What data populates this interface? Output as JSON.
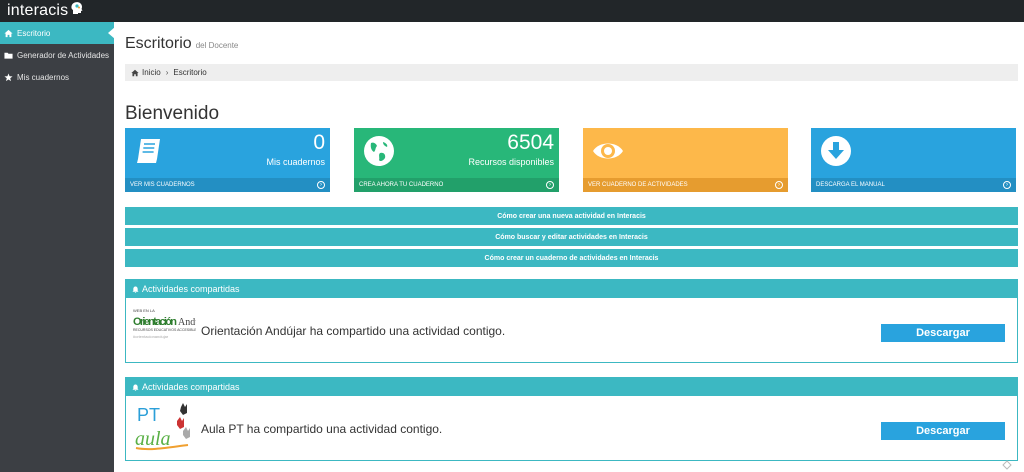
{
  "app": {
    "logo_text": "interacis"
  },
  "sidebar": {
    "items": [
      {
        "label": "Escritorio",
        "icon": "home-icon",
        "active": true
      },
      {
        "label": "Generador de Actividades",
        "icon": "folder-icon",
        "active": false
      },
      {
        "label": "Mis cuadernos",
        "icon": "star-icon",
        "active": false
      }
    ]
  },
  "header": {
    "title": "Escritorio",
    "subtitle": "del Docente"
  },
  "breadcrumb": {
    "home": "Inicio",
    "current": "Escritorio"
  },
  "welcome": "Bienvenido",
  "cards": [
    {
      "value": "0",
      "label": "Mis cuadernos",
      "footer": "VER MIS CUADERNOS",
      "color": "#29a3de",
      "foot_color": "#238fc3",
      "icon": "notebook-icon"
    },
    {
      "value": "6504",
      "label": "Recursos disponibles",
      "footer": "CREA AHORA TU CUADERNO",
      "color": "#28b779",
      "foot_color": "#22a06a",
      "icon": "globe-icon"
    },
    {
      "value": "",
      "label": "",
      "footer": "VER CUADERNO DE ACTIVIDADES",
      "color": "#fdb84a",
      "foot_color": "#e69c2f",
      "icon": "eye-icon"
    },
    {
      "value": "",
      "label": "",
      "footer": "DESCARGA EL MANUAL",
      "color": "#29a3de",
      "foot_color": "#238fc3",
      "icon": "download-icon"
    }
  ],
  "help_links": [
    "Cómo crear una nueva actividad en Interacis",
    "Cómo buscar y editar actividades en Interacis",
    "Cómo crear un cuaderno de actividades en Interacis"
  ],
  "shared": [
    {
      "header": "Actividades compartidas",
      "text": "Orientación Andújar ha compartido una actividad contigo.",
      "button": "Descargar",
      "logo_text": "Orientación Andújar"
    },
    {
      "header": "Actividades compartidas",
      "text": "Aula PT ha compartido una actividad contigo.",
      "button": "Descargar",
      "logo_text": "PT aula"
    }
  ],
  "colors": {
    "accent": "#3cb8c2",
    "sidebar_bg": "#3c3f44",
    "topbar_bg": "#222629",
    "button_blue": "#29a3de"
  }
}
